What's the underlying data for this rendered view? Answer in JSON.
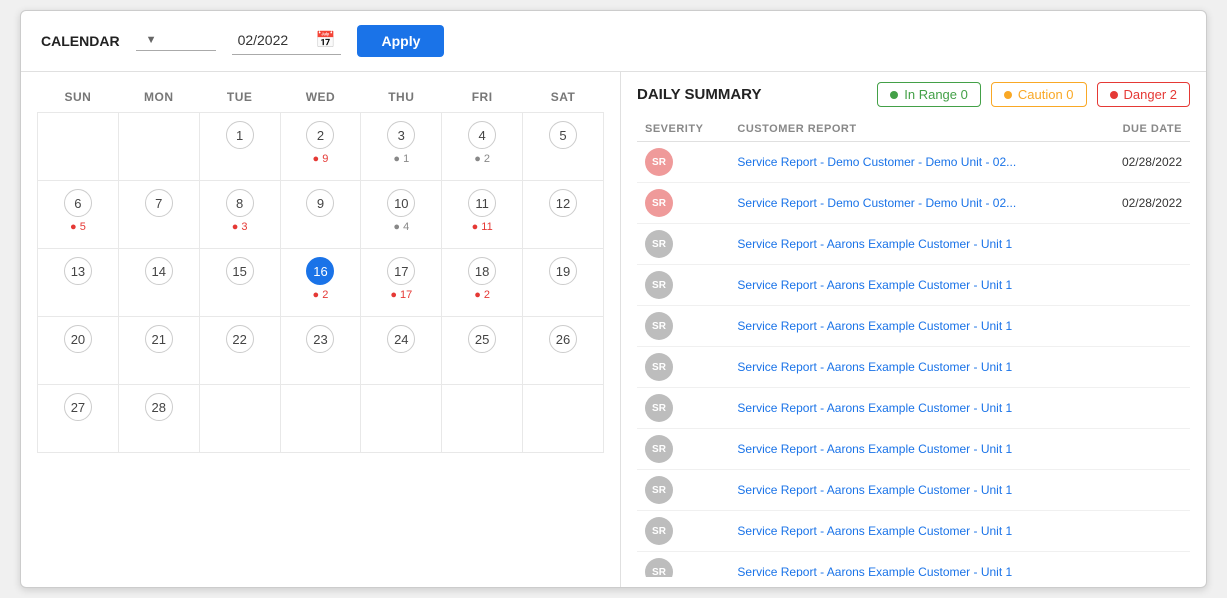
{
  "toolbar": {
    "calendar_label": "CALENDAR",
    "dropdown_text": "",
    "date_value": "02/2022",
    "apply_label": "Apply"
  },
  "badges": [
    {
      "id": "in-range",
      "label": "In Range 0",
      "dot_class": "badge-dot-green",
      "class": "badge-green"
    },
    {
      "id": "caution",
      "label": "Caution 0",
      "dot_class": "badge-dot-orange",
      "class": "badge-orange"
    },
    {
      "id": "danger",
      "label": "Danger 2",
      "dot_class": "badge-dot-red",
      "class": "badge-red"
    }
  ],
  "summary_title": "DAILY SUMMARY",
  "table_headers": [
    "SEVERITY",
    "CUSTOMER REPORT",
    "DUE DATE"
  ],
  "calendar": {
    "headers": [
      "SUN",
      "MON",
      "TUE",
      "WED",
      "THU",
      "FRI",
      "SAT"
    ],
    "weeks": [
      [
        {
          "day": null
        },
        {
          "day": null
        },
        {
          "day": 1,
          "dot": null,
          "dot_color": null
        },
        {
          "day": 2,
          "dot": "● 9",
          "dot_color": "red"
        },
        {
          "day": 3,
          "dot": "● 1",
          "dot_color": "gray"
        },
        {
          "day": 4,
          "dot": "● 2",
          "dot_color": "gray"
        },
        {
          "day": 5,
          "dot": null,
          "dot_color": null
        }
      ],
      [
        {
          "day": 6,
          "dot": null,
          "dot_color": null
        },
        {
          "day": 7,
          "dot": null,
          "dot_color": null
        },
        {
          "day": 8,
          "dot": null,
          "dot_color": null
        },
        {
          "day": 9,
          "dot": null,
          "dot_color": null
        },
        {
          "day": 10,
          "dot": "● 4",
          "dot_color": "gray"
        },
        {
          "day": 11,
          "dot": "● 11",
          "dot_color": "red"
        },
        {
          "day": 12,
          "dot": null,
          "dot_color": null
        }
      ],
      [
        {
          "day": null,
          "extra": "● 5",
          "extra_color": "red",
          "attach_to": 6
        },
        {
          "day": null,
          "extra": "● 3",
          "extra_color": "red",
          "attach_to": 7
        }
      ],
      [
        {
          "day": 13,
          "dot": null,
          "dot_color": null
        },
        {
          "day": 14,
          "dot": null,
          "dot_color": null
        },
        {
          "day": 15,
          "dot": null,
          "dot_color": null
        },
        {
          "day": 16,
          "dot": "● 2",
          "dot_color": "red",
          "today": true
        },
        {
          "day": 17,
          "dot": "● 17",
          "dot_color": "red"
        },
        {
          "day": 18,
          "dot": "● 2",
          "dot_color": "red"
        },
        {
          "day": 19,
          "dot": null,
          "dot_color": null
        }
      ],
      [
        {
          "day": 20,
          "dot": null,
          "dot_color": null
        },
        {
          "day": 21,
          "dot": null,
          "dot_color": null
        },
        {
          "day": 22,
          "dot": null,
          "dot_color": null
        },
        {
          "day": 23,
          "dot": null,
          "dot_color": null
        },
        {
          "day": 24,
          "dot": null,
          "dot_color": null
        },
        {
          "day": 25,
          "dot": null,
          "dot_color": null
        },
        {
          "day": 26,
          "dot": null,
          "dot_color": null
        }
      ],
      [
        {
          "day": 27,
          "dot": null,
          "dot_color": null
        },
        {
          "day": 28,
          "dot": null,
          "dot_color": null
        },
        {
          "day": null
        },
        {
          "day": null
        },
        {
          "day": null
        },
        {
          "day": null
        },
        {
          "day": null
        }
      ]
    ]
  },
  "reports": [
    {
      "severity": "SR",
      "badge_class": "sr-badge-red",
      "link": "Service Report - Demo Customer - Demo Unit - 02...",
      "due_date": "02/28/2022"
    },
    {
      "severity": "SR",
      "badge_class": "sr-badge-red",
      "link": "Service Report - Demo Customer - Demo Unit - 02...",
      "due_date": "02/28/2022"
    },
    {
      "severity": "SR",
      "badge_class": "sr-badge-gray",
      "link": "Service Report - Aarons Example Customer - Unit 1",
      "due_date": ""
    },
    {
      "severity": "SR",
      "badge_class": "sr-badge-gray",
      "link": "Service Report - Aarons Example Customer - Unit 1",
      "due_date": ""
    },
    {
      "severity": "SR",
      "badge_class": "sr-badge-gray",
      "link": "Service Report - Aarons Example Customer - Unit 1",
      "due_date": ""
    },
    {
      "severity": "SR",
      "badge_class": "sr-badge-gray",
      "link": "Service Report - Aarons Example Customer - Unit 1",
      "due_date": ""
    },
    {
      "severity": "SR",
      "badge_class": "sr-badge-gray",
      "link": "Service Report - Aarons Example Customer - Unit 1",
      "due_date": ""
    },
    {
      "severity": "SR",
      "badge_class": "sr-badge-gray",
      "link": "Service Report - Aarons Example Customer - Unit 1",
      "due_date": ""
    },
    {
      "severity": "SR",
      "badge_class": "sr-badge-gray",
      "link": "Service Report - Aarons Example Customer - Unit 1",
      "due_date": ""
    },
    {
      "severity": "SR",
      "badge_class": "sr-badge-gray",
      "link": "Service Report - Aarons Example Customer - Unit 1",
      "due_date": ""
    },
    {
      "severity": "SR",
      "badge_class": "sr-badge-gray",
      "link": "Service Report - Aarons Example Customer - Unit 1",
      "due_date": ""
    }
  ]
}
